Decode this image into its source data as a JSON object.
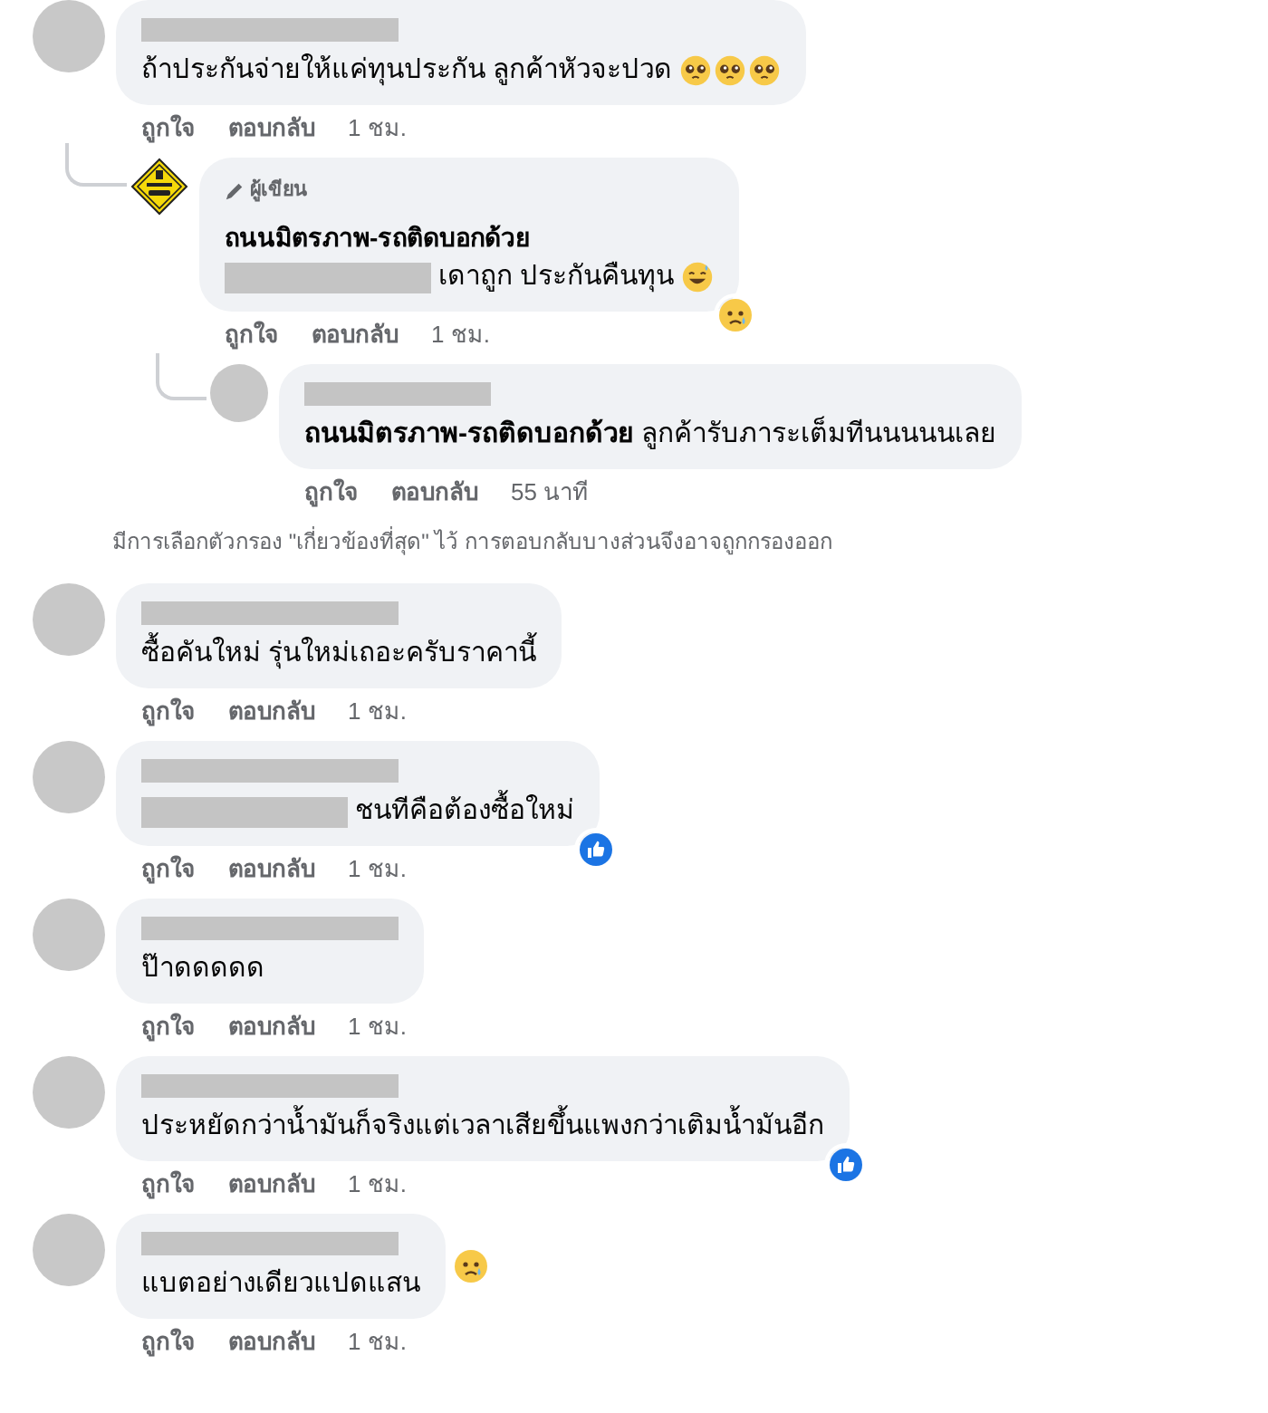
{
  "thread": {
    "avatar": {
      "kind": "person"
    },
    "name_hidden": true,
    "text": "ถ้าประกันจ่ายให้แค่ทุนประกัน ลูกค้าหัวจะปวด",
    "emoji": [
      {
        "kind": "pleading"
      },
      {
        "kind": "pleading"
      },
      {
        "kind": "pleading"
      }
    ],
    "actions": [
      "ถูกใจ",
      "ตอบกลับ",
      "1 ชม."
    ],
    "children": [
      {
        "avatar": {
          "kind": "page"
        },
        "badge": "ผู้เขียน",
        "author": "ถนนมิตรภาพ-รถติดบอกด้วย",
        "mention_hidden": true,
        "text": "เดาถูก ประกันคืนทุน",
        "emoji": [
          {
            "kind": "grin-sweat"
          }
        ],
        "reaction": {
          "kind": "sad",
          "inline": false
        },
        "actions": [
          "ถูกใจ",
          "ตอบกลับ",
          "1 ชม."
        ],
        "children": [
          {
            "avatar": {
              "kind": "person"
            },
            "name_hidden": true,
            "mention": "ถนนมิตรภาพ-รถติดบอกด้วย",
            "text": "ลูกค้ารับภาระเต็มทีนนนนนเลย",
            "actions": [
              "ถูกใจ",
              "ตอบกลับ",
              "55 นาที"
            ]
          }
        ]
      }
    ]
  },
  "filter_notice": "มีการเลือกตัวกรอง \"เกี่ยวข้องที่สุด\" ไว้ การตอบกลับบางส่วนจึงอาจถูกกรองออก",
  "comments": [
    {
      "avatar": {
        "kind": "person"
      },
      "name_hidden": true,
      "text": "ซื้อคันใหม่ รุ่นใหม่เถอะครับราคานี้",
      "actions": [
        "ถูกใจ",
        "ตอบกลับ",
        "1 ชม."
      ]
    },
    {
      "avatar": {
        "kind": "person"
      },
      "name_hidden": true,
      "mention_hidden": true,
      "text": "ชนทีคือต้องซื้อใหม่",
      "reaction": {
        "kind": "like",
        "inline": false
      },
      "actions": [
        "ถูกใจ",
        "ตอบกลับ",
        "1 ชม."
      ]
    },
    {
      "avatar": {
        "kind": "person"
      },
      "name_hidden": true,
      "text": "ป๊าดดดดด",
      "actions": [
        "ถูกใจ",
        "ตอบกลับ",
        "1 ชม."
      ]
    },
    {
      "avatar": {
        "kind": "person"
      },
      "name_hidden": true,
      "text": "ประหยัดกว่าน้ำมันก็จริงแต่เวลาเสียขึ้นแพงกว่าเติมน้ำมันอีก",
      "reaction": {
        "kind": "like",
        "inline": false
      },
      "actions": [
        "ถูกใจ",
        "ตอบกลับ",
        "1 ชม."
      ]
    },
    {
      "avatar": {
        "kind": "person"
      },
      "name_hidden": true,
      "text": "แบตอย่างเดียวแปดแสน",
      "reaction": {
        "kind": "sad",
        "inline": true
      },
      "actions": [
        "ถูกใจ",
        "ตอบกลับ",
        "1 ชม."
      ]
    }
  ]
}
